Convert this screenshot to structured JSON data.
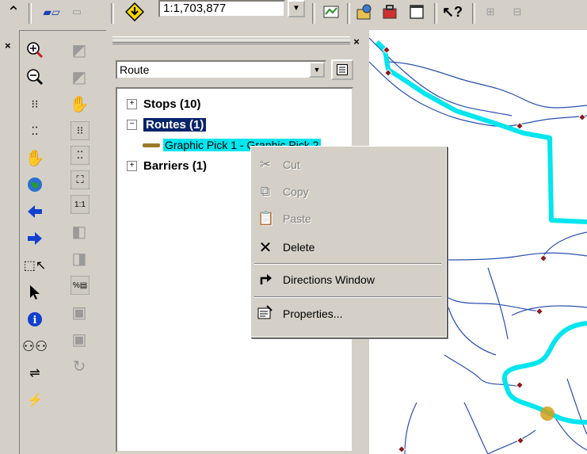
{
  "toolbar": {
    "scale_value": "1:1,703,877",
    "icons": [
      "up-arrow-icon",
      "layer-icon",
      "warning-icon",
      "scale-dropdown",
      "select-features-icon",
      "catalog-icon",
      "toolbox-icon",
      "window-icon",
      "whats-this-icon",
      "grid-icon",
      "grid-icon-2"
    ]
  },
  "toc": {
    "close_label": "×",
    "layer_select": "Route",
    "tree": {
      "stops": "Stops (10)",
      "routes": "Routes (1)",
      "route_item": "Graphic Pick 1 - Graphic Pick 2",
      "barriers": "Barriers (1)"
    }
  },
  "left_strip": {
    "close_label": "×"
  },
  "context_menu": {
    "items": [
      {
        "label": "Cut",
        "icon": "cut-icon",
        "enabled": false
      },
      {
        "label": "Copy",
        "icon": "copy-icon",
        "enabled": false
      },
      {
        "label": "Paste",
        "icon": "paste-icon",
        "enabled": false
      },
      {
        "label": "Delete",
        "icon": "delete-icon",
        "enabled": true
      },
      {
        "label": "Directions Window",
        "icon": "directions-icon",
        "enabled": true
      },
      {
        "label": "Properties...",
        "icon": "properties-icon",
        "enabled": true
      }
    ]
  },
  "colors": {
    "route": "#00e5ee",
    "roads": "#2a4fb0",
    "stop": "#c0392b",
    "selection": "#0a246a",
    "barrier": "#d4a017"
  }
}
